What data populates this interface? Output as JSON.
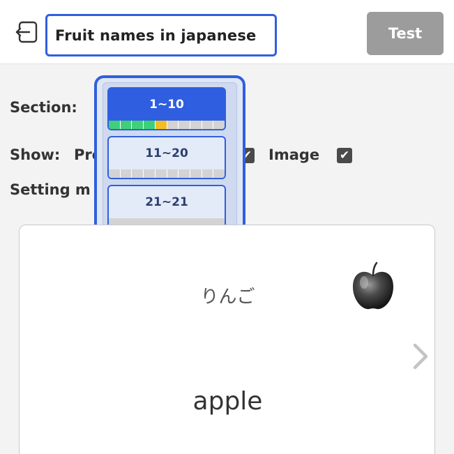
{
  "header": {
    "title": "Fruit names in japanese",
    "test_label": "Test",
    "back_icon": "exit-icon"
  },
  "settings": {
    "section_label": "Section:",
    "show_label": "Show:",
    "show_partial": "Pro",
    "image_label": "Image",
    "setting_partial": "Setting m",
    "checkbox_mark": "✔"
  },
  "dropdown": {
    "options": [
      {
        "label": "1~10",
        "selected": true,
        "progress": [
          "green",
          "green",
          "green",
          "green",
          "yellow",
          "gray",
          "gray",
          "gray",
          "gray",
          "gray"
        ]
      },
      {
        "label": "11~20",
        "selected": false,
        "progress": [
          "gray",
          "gray",
          "gray",
          "gray",
          "gray",
          "gray",
          "gray",
          "gray",
          "gray",
          "gray"
        ]
      },
      {
        "label": "21~21",
        "selected": false,
        "progress": [
          "gray"
        ]
      }
    ]
  },
  "colors": {
    "accent": "#2f5fe0",
    "green": "#3fcf7a",
    "yellow": "#f2bd22",
    "gray": "#d3d3d3"
  },
  "card": {
    "pronunciation": "りんご",
    "word": "apple",
    "image_icon": "apple-icon",
    "next_icon": "chevron-right-icon"
  }
}
